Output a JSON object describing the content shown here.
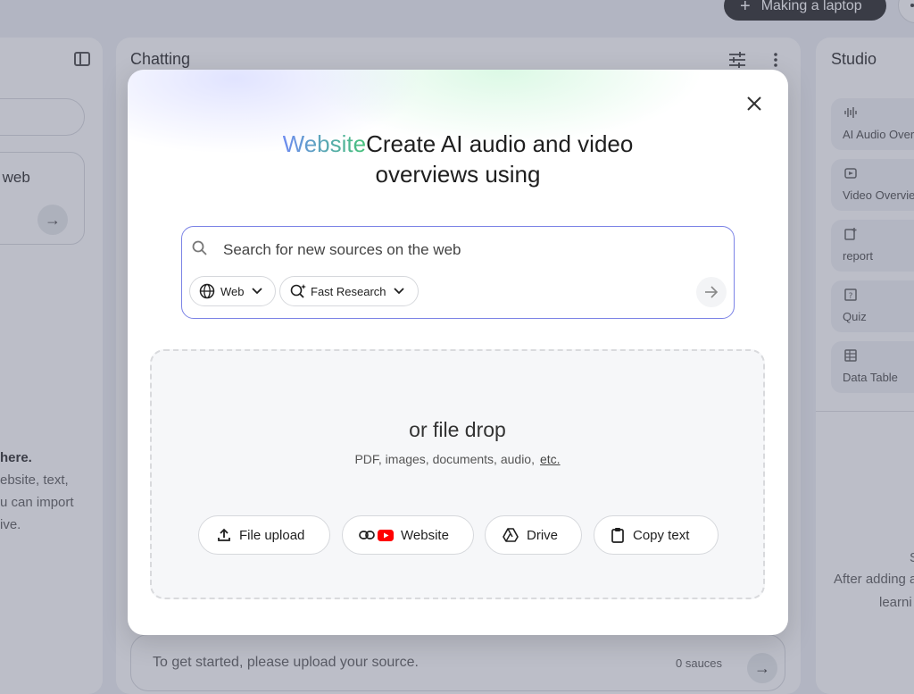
{
  "header": {
    "new_notebook_label": "Making a laptop"
  },
  "sources_panel": {
    "web_card_text": "ne web",
    "empty_title": "here.",
    "empty_lines": [
      "ebsite, text,",
      "u can import",
      "ive."
    ]
  },
  "chat_panel": {
    "title": "Chatting",
    "input_placeholder": "To get started, please upload your source.",
    "source_count": "0 sauces"
  },
  "studio_panel": {
    "title": "Studio",
    "tiles": [
      {
        "label": "AI Audio Overview",
        "icon": "audio-waveform-icon"
      },
      {
        "label": "Video Overview",
        "icon": "video-icon"
      },
      {
        "label": "report",
        "icon": "report-icon"
      },
      {
        "label": "Quiz",
        "icon": "quiz-icon"
      },
      {
        "label": "Data Table",
        "icon": "table-icon"
      }
    ],
    "hint_s": "S",
    "hint_line1": "After adding a",
    "hint_line2": "learni"
  },
  "modal": {
    "headline_highlight": "Website",
    "headline_text": "Create AI audio and video overviews using",
    "search": {
      "placeholder": "Search for new sources on the web",
      "value": "",
      "chip_web": "Web",
      "chip_research": "Fast Research"
    },
    "drop_zone": {
      "title": "or file drop",
      "subtitle": "PDF, images, documents, audio,",
      "etc_link": "etc."
    },
    "buttons": {
      "file_upload": "File upload",
      "website": "Website",
      "drive": "Drive",
      "copy_text": "Copy text"
    }
  },
  "colors": {
    "accent_border": "#7b83e6",
    "headline_gradient_start": "#6e8cf0",
    "headline_gradient_end": "#46c27a",
    "youtube_red": "#ff0000",
    "dark_pill": "#1f1f1f"
  }
}
